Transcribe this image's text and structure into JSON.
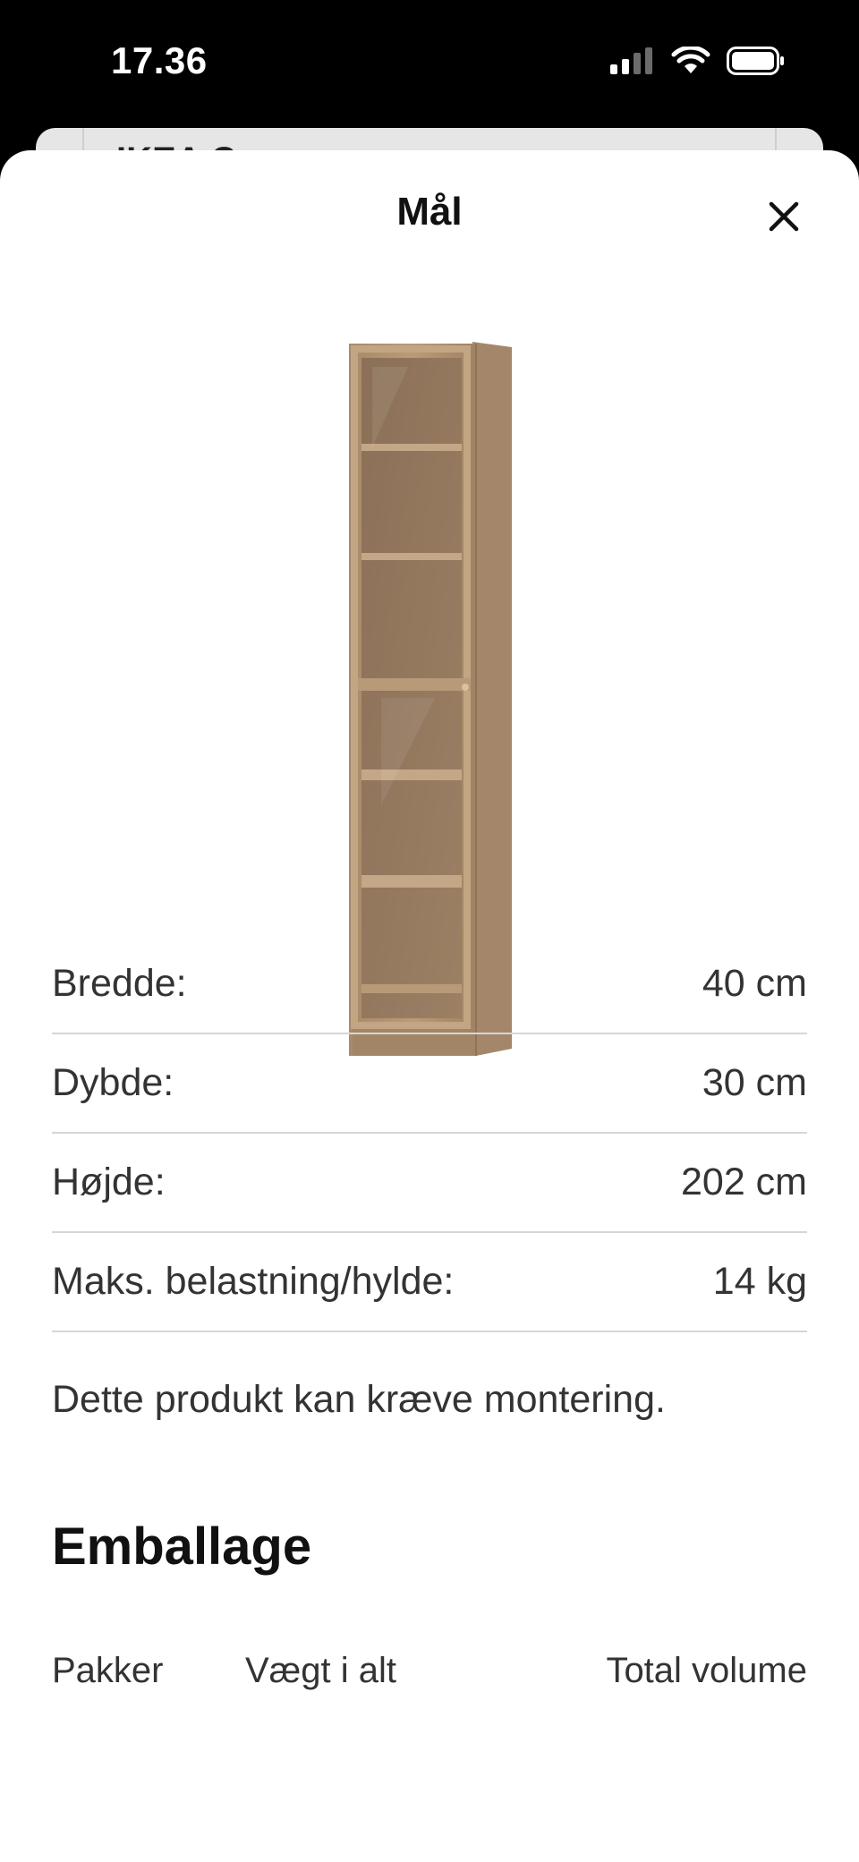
{
  "status_bar": {
    "time": "17.36",
    "icons": [
      "signal-icon",
      "wifi-icon",
      "battery-icon"
    ]
  },
  "background_sheet": {
    "title": "IKEA Com..."
  },
  "modal": {
    "title": "Mål",
    "close_icon": "close-icon"
  },
  "product": {
    "image": "product-image-bookcase-glass-door"
  },
  "dimensions": [
    {
      "label": "Bredde:",
      "value": "40 cm"
    },
    {
      "label": "Dybde:",
      "value": "30 cm"
    },
    {
      "label": "Højde:",
      "value": "202 cm"
    },
    {
      "label": "Maks. belastning/hylde:",
      "value": "14 kg"
    }
  ],
  "assembly_note": "Dette produkt kan kræve montering.",
  "packaging": {
    "heading": "Emballage",
    "columns": [
      "Pakker",
      "Vægt i alt",
      "Total volume"
    ]
  },
  "colors": {
    "wood": "#b39674",
    "wood_dark": "#8e7356",
    "divider": "#d6d6d6",
    "text": "#333333"
  }
}
